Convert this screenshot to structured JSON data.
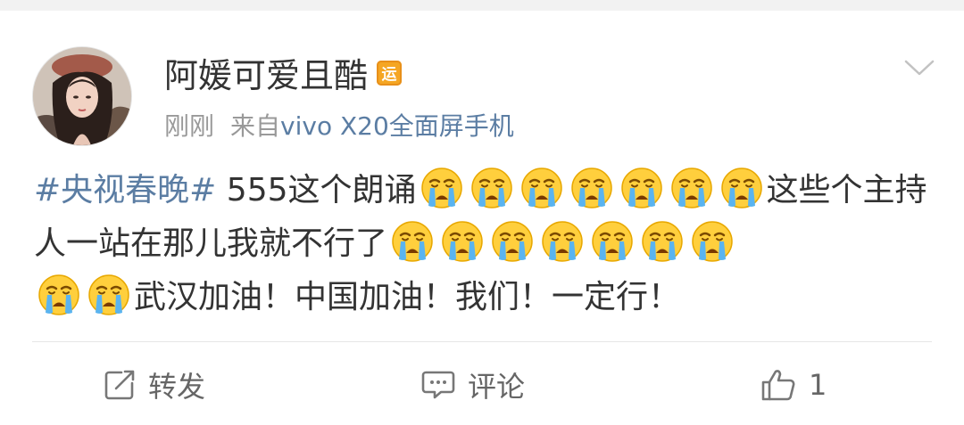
{
  "post": {
    "username": "阿媛可爱且酷",
    "badge": "运",
    "time": "刚刚",
    "source_prefix": "来自",
    "device": "vivo X20全面屏手机",
    "topic": "#央视春晚#",
    "text_1": " 555这个朗诵",
    "text_2": "这些个主持人一站在那儿我就不行了",
    "text_3": "武汉加油！中国加油！我们！一定行！"
  },
  "emoji": {
    "name": "crying-face-icon",
    "count_1": 7,
    "count_2": 7,
    "count_3": 2
  },
  "actions": {
    "repost_label": "转发",
    "comment_label": "评论",
    "like_count": "1"
  },
  "colors": {
    "link": "#5b7da3",
    "meta": "#999999",
    "text": "#333333",
    "badge": "#f5a623"
  }
}
